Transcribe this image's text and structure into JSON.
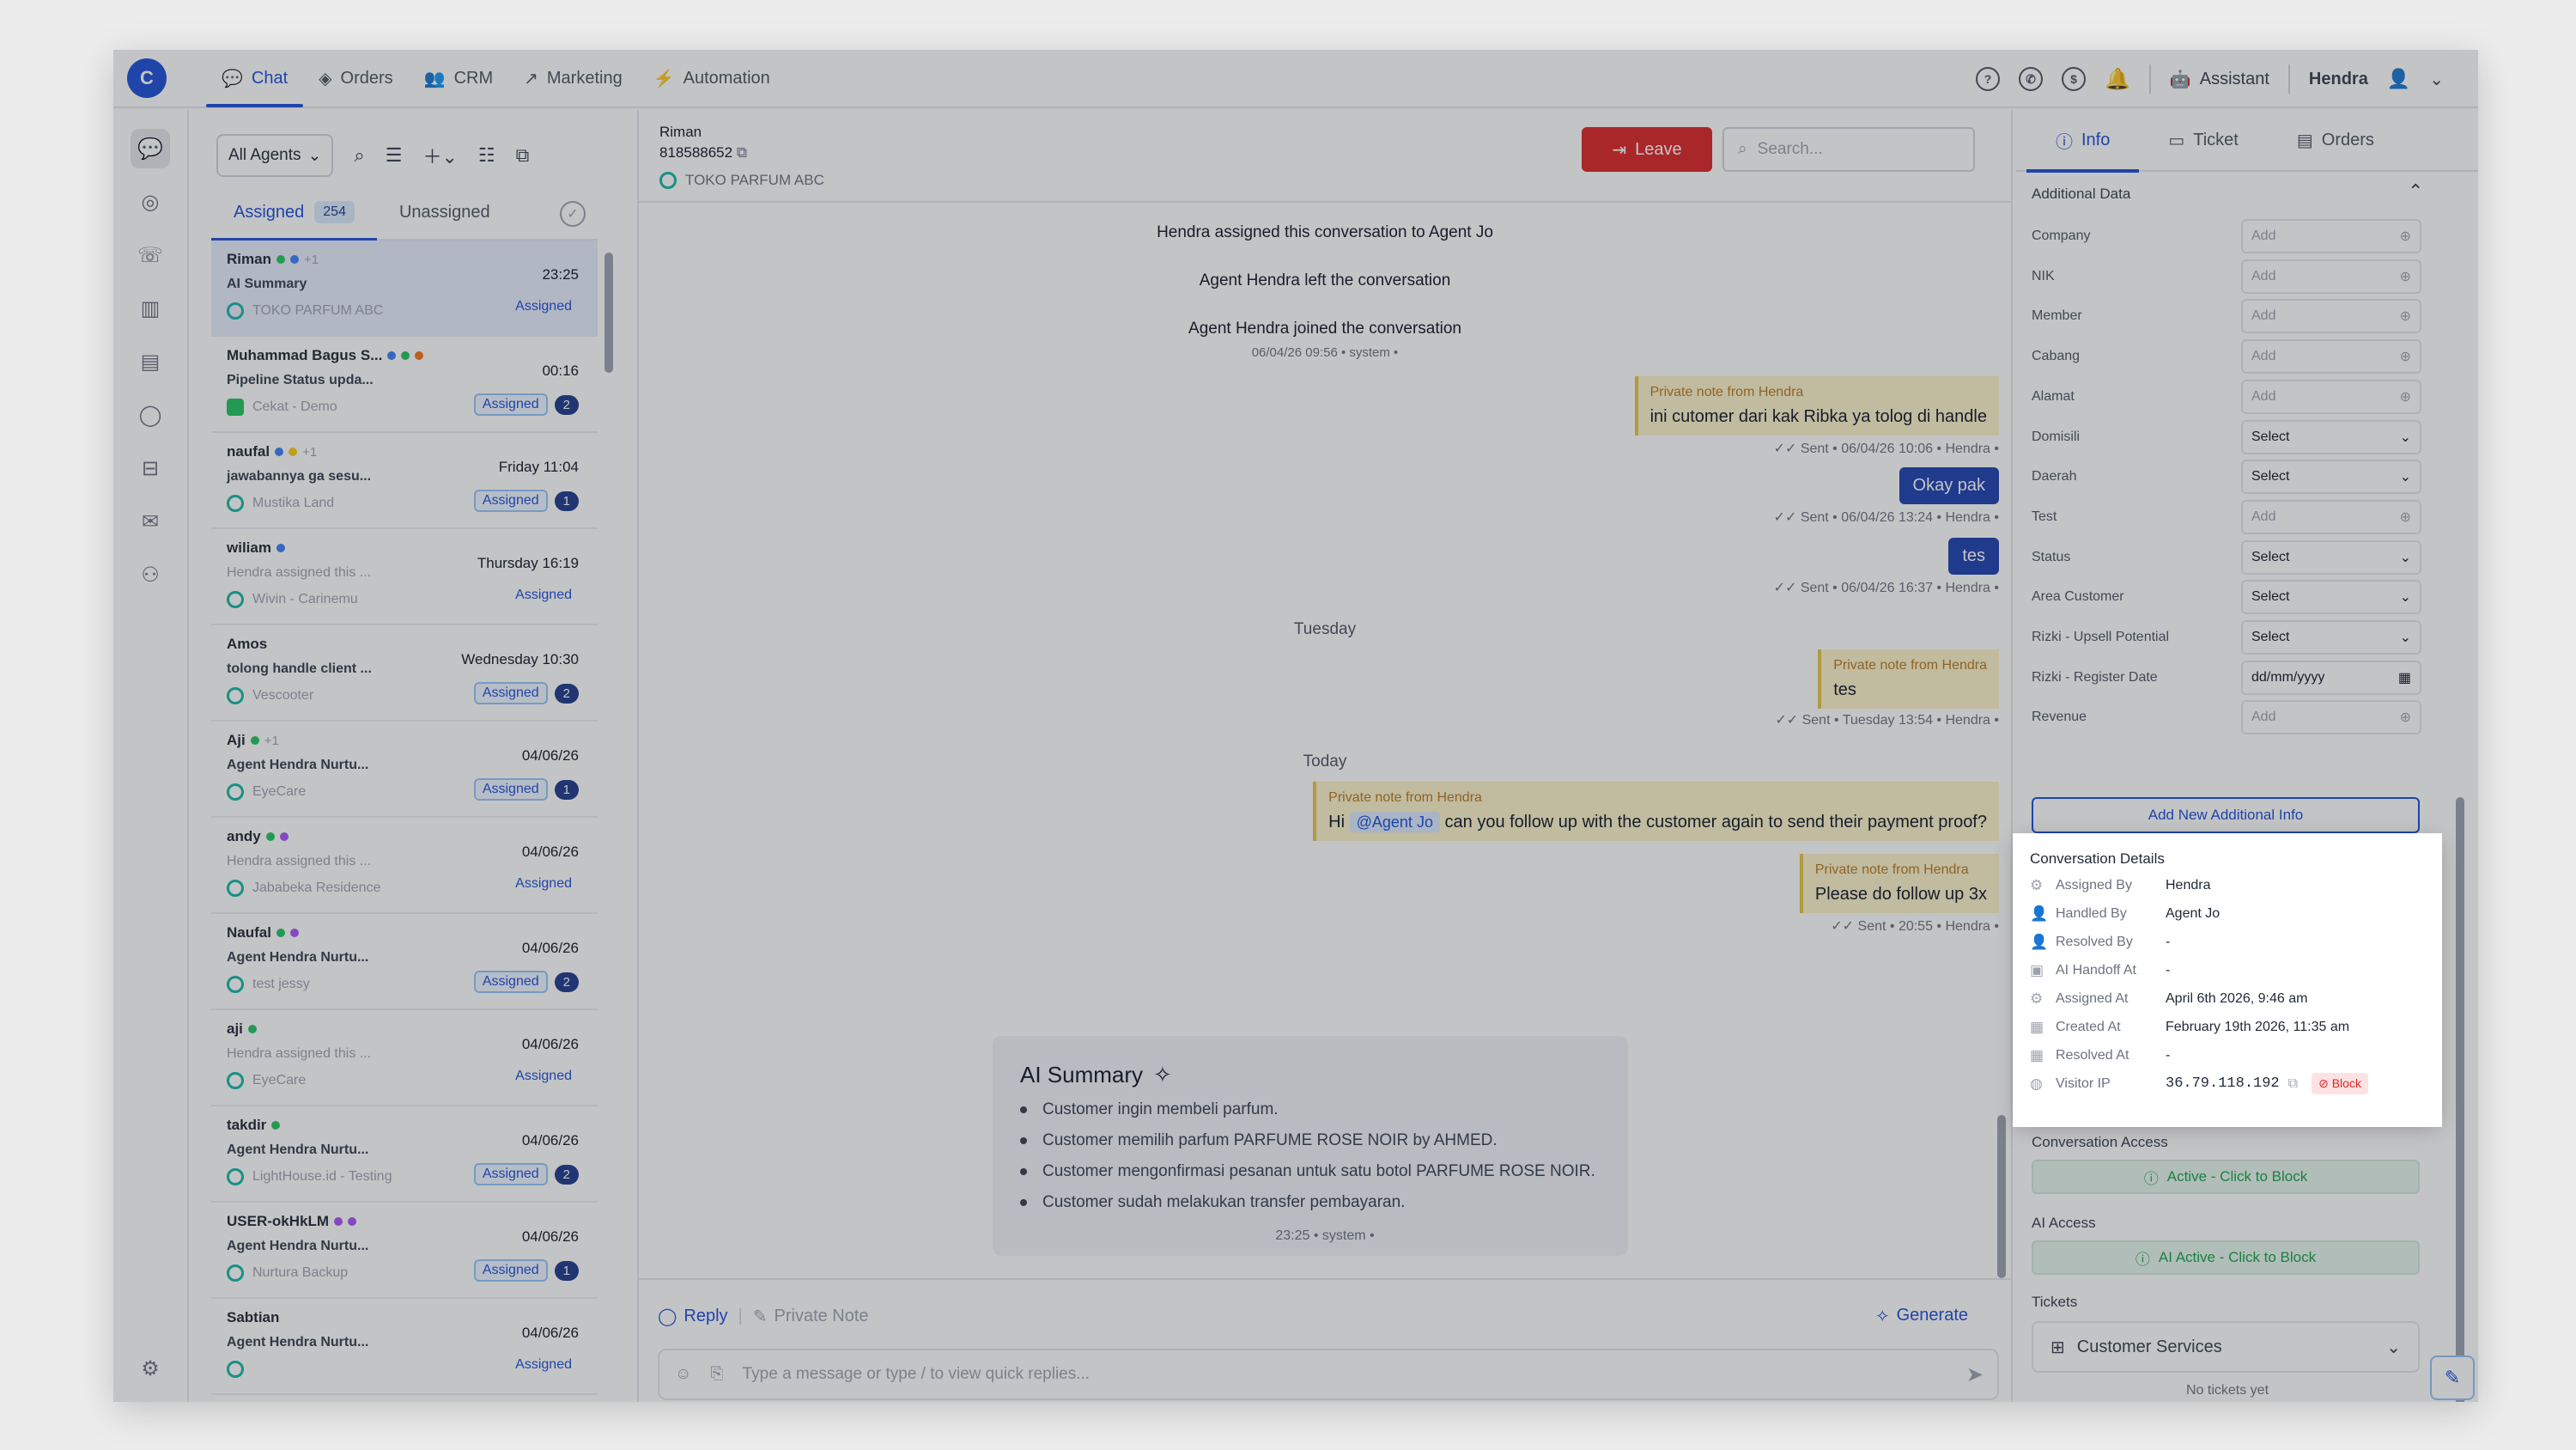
{
  "nav": {
    "items": [
      {
        "label": "Chat",
        "icon": "chat-bubble-icon"
      },
      {
        "label": "Orders",
        "icon": "package-icon"
      },
      {
        "label": "CRM",
        "icon": "users-icon"
      },
      {
        "label": "Marketing",
        "icon": "trend-icon"
      },
      {
        "label": "Automation",
        "icon": "bolt-icon"
      }
    ],
    "assistant_label": "Assistant",
    "user_name": "Hendra"
  },
  "list": {
    "agents_filter": "All Agents",
    "tab_assigned": "Assigned",
    "assigned_count": "254",
    "tab_unassigned": "Unassigned",
    "conversations": [
      {
        "name": "Riman",
        "extra": "+1",
        "time": "23:25",
        "preview": "AI Summary",
        "inbox": "TOKO PARFUM ABC",
        "status": "Assigned",
        "unread": ""
      },
      {
        "name": "Muhammad Bagus S...",
        "extra": "",
        "time": "00:16",
        "preview": "Pipeline Status upda...",
        "inbox": "Cekat - Demo",
        "status": "Assigned",
        "unread": "2"
      },
      {
        "name": "naufal",
        "extra": "+1",
        "time": "Friday 11:04",
        "preview": "jawabannya ga sesu...",
        "inbox": "Mustika Land",
        "status": "Assigned",
        "unread": "1"
      },
      {
        "name": "wiliam",
        "extra": "",
        "time": "Thursday 16:19",
        "preview": "Hendra assigned this ...",
        "inbox": "Wivin - Carinemu",
        "status": "Assigned",
        "unread": ""
      },
      {
        "name": "Amos",
        "extra": "",
        "time": "Wednesday 10:30",
        "preview": "tolong handle client ...",
        "inbox": "Vescooter",
        "status": "Assigned",
        "unread": "2"
      },
      {
        "name": "Aji",
        "extra": "+1",
        "time": "04/06/26",
        "preview": "Agent Hendra Nurtu...",
        "inbox": "EyeCare",
        "status": "Assigned",
        "unread": "1"
      },
      {
        "name": "andy",
        "extra": "",
        "time": "04/06/26",
        "preview": "Hendra assigned this ...",
        "inbox": "Jababeka Residence",
        "status": "Assigned",
        "unread": ""
      },
      {
        "name": "Naufal",
        "extra": "",
        "time": "04/06/26",
        "preview": "Agent Hendra Nurtu...",
        "inbox": "test jessy",
        "status": "Assigned",
        "unread": "2"
      },
      {
        "name": "aji",
        "extra": "",
        "time": "04/06/26",
        "preview": "Hendra assigned this ...",
        "inbox": "EyeCare",
        "status": "Assigned",
        "unread": ""
      },
      {
        "name": "takdir",
        "extra": "",
        "time": "04/06/26",
        "preview": "Agent Hendra Nurtu...",
        "inbox": "LightHouse.id - Testing",
        "status": "Assigned",
        "unread": "2"
      },
      {
        "name": "USER-okHkLM",
        "extra": "",
        "time": "04/06/26",
        "preview": "Agent Hendra Nurtu...",
        "inbox": "Nurtura Backup",
        "status": "Assigned",
        "unread": "1"
      },
      {
        "name": "Sabtian",
        "extra": "",
        "time": "04/06/26",
        "preview": "Agent Hendra Nurtu...",
        "inbox": "",
        "status": "Assigned",
        "unread": ""
      }
    ]
  },
  "chat": {
    "customer_name": "Riman",
    "customer_phone": "818588652",
    "inbox": "TOKO PARFUM ABC",
    "leave_label": "Leave",
    "search_placeholder": "Search...",
    "sys1": "Hendra assigned this conversation to Agent Jo",
    "sys2": "Agent Hendra left the conversation",
    "sys3": "Agent Hendra joined the conversation",
    "sys3_meta": "06/04/26 09:56 • system •",
    "note1_label": "Private note from Hendra",
    "note1_text": "ini cutomer dari kak Ribka ya tolog di handle",
    "note1_meta": "Sent • 06/04/26 10:06 • Hendra •",
    "msg1": "Okay pak",
    "msg1_meta": "Sent • 06/04/26 13:24 • Hendra •",
    "msg2": "tes",
    "msg2_meta": "Sent • 06/04/26 16:37 • Hendra •",
    "day1": "Tuesday",
    "note2_label": "Private note from Hendra",
    "note2_text": "tes",
    "note2_meta": "Sent • Tuesday 13:54 • Hendra •",
    "day2": "Today",
    "note3_label": "Private note from Hendra",
    "note3_hi": "Hi",
    "note3_mention": "@Agent Jo",
    "note3_text": "can you follow up with the customer again to send their payment proof?",
    "note4_label": "Private note from Hendra",
    "note4_text": "Please do follow up 3x",
    "note4_meta": "Sent • 20:55 • Hendra •",
    "ai_title": "AI Summary",
    "ai_items": [
      "Customer ingin membeli parfum.",
      "Customer memilih parfum PARFUME ROSE NOIR by AHMED.",
      "Customer mengonfirmasi pesanan untuk satu botol PARFUME ROSE NOIR.",
      "Customer sudah melakukan transfer pembayaran."
    ],
    "ai_meta": "23:25 • system •",
    "reply_label": "Reply",
    "private_note_label": "Private Note",
    "generate_label": "Generate",
    "composer_placeholder": "Type a message or type / to view quick replies..."
  },
  "side": {
    "tab_info": "Info",
    "tab_ticket": "Ticket",
    "tab_orders": "Orders",
    "additional_title": "Additional Data",
    "fields": [
      {
        "label": "Company",
        "value": "Add",
        "kind": "add"
      },
      {
        "label": "NIK",
        "value": "Add",
        "kind": "add"
      },
      {
        "label": "Member",
        "value": "Add",
        "kind": "add"
      },
      {
        "label": "Cabang",
        "value": "Add",
        "kind": "add"
      },
      {
        "label": "Alamat",
        "value": "Add",
        "kind": "add"
      },
      {
        "label": "Domisili",
        "value": "Select",
        "kind": "select"
      },
      {
        "label": "Daerah",
        "value": "Select",
        "kind": "select"
      },
      {
        "label": "Test",
        "value": "Add",
        "kind": "add"
      },
      {
        "label": "Status",
        "value": "Select",
        "kind": "select"
      },
      {
        "label": "Area Customer",
        "value": "Select",
        "kind": "select"
      },
      {
        "label": "Rizki - Upsell Potential",
        "value": "Select",
        "kind": "select"
      },
      {
        "label": "Rizki - Register Date",
        "value": "dd/mm/yyyy",
        "kind": "date"
      },
      {
        "label": "Revenue",
        "value": "Add",
        "kind": "add"
      }
    ],
    "add_info_label": "Add New Additional Info",
    "conv_details_title": "Conversation Details",
    "details": [
      {
        "label": "Assigned By",
        "value": "Hendra"
      },
      {
        "label": "Handled By",
        "value": "Agent Jo"
      },
      {
        "label": "Resolved By",
        "value": "-"
      },
      {
        "label": "AI Handoff At",
        "value": "-"
      },
      {
        "label": "Assigned At",
        "value": "April 6th 2026, 9:46 am"
      },
      {
        "label": "Created At",
        "value": "February 19th 2026, 11:35 am"
      },
      {
        "label": "Resolved At",
        "value": "-"
      }
    ],
    "visitor_ip_label": "Visitor IP",
    "visitor_ip": "36.79.118.192",
    "block_label": "Block",
    "conv_access_title": "Conversation Access",
    "conv_access_status": "Active - Click to Block",
    "ai_access_title": "AI Access",
    "ai_access_status": "AI Active - Click to Block",
    "tickets_title": "Tickets",
    "ticket_category": "Customer Services",
    "no_tickets": "No tickets yet"
  }
}
